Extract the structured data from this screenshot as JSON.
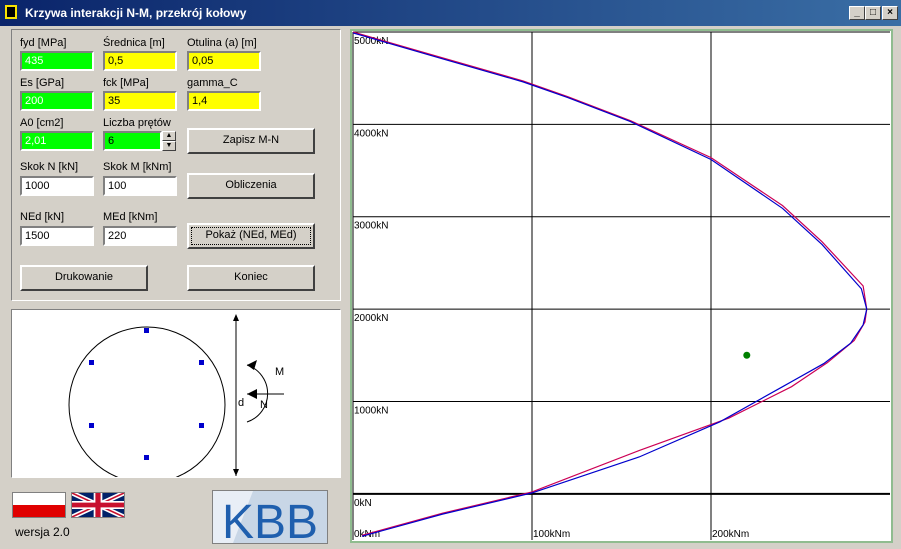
{
  "window": {
    "title": "Krzywa interakcji N-M, przekrój kołowy",
    "min_label": "_",
    "max_label": "□",
    "close_label": "×"
  },
  "inputs": {
    "fyd": {
      "label": "fyd [MPa]",
      "value": "435"
    },
    "srednica": {
      "label": "Średnica [m]",
      "value": "0,5"
    },
    "otulina": {
      "label": "Otulina (a) [m]",
      "value": "0,05"
    },
    "es": {
      "label": "Es [GPa]",
      "value": "200"
    },
    "fck": {
      "label": "fck [MPa]",
      "value": "35"
    },
    "gamma_c": {
      "label": "gamma_C",
      "value": "1,4"
    },
    "a0": {
      "label": "A0 [cm2]",
      "value": "2,01"
    },
    "liczba_pretow": {
      "label": "Liczba prętów",
      "value": "6"
    },
    "skok_n": {
      "label": "Skok N [kN]",
      "value": "1000"
    },
    "skok_m": {
      "label": "Skok M [kNm]",
      "value": "100"
    },
    "ned": {
      "label": "NEd [kN]",
      "value": "1500"
    },
    "med": {
      "label": "MEd [kNm]",
      "value": "220"
    }
  },
  "buttons": {
    "zapisz": "Zapisz M-N",
    "obliczenia": "Obliczenia",
    "pokaz": "Pokaż (NEd, MEd)",
    "drukowanie": "Drukowanie",
    "koniec": "Koniec"
  },
  "diagram": {
    "m_label": "M",
    "n_label": "N",
    "d_label": "d",
    "bars": 6
  },
  "logo_text": "KBB",
  "version": "wersja 2.0",
  "colors": {
    "curve1": "#cc0055",
    "curve2": "#0000cc",
    "point": "#008000",
    "green_field": "#00ff00",
    "yellow_field": "#ffff00"
  },
  "chart_data": {
    "type": "line",
    "xlabel": "",
    "ylabel": "",
    "xlim": [
      0,
      300
    ],
    "ylim": [
      -500,
      5000
    ],
    "x_ticks": [
      "0kNm",
      "100kNm",
      "200kNm"
    ],
    "y_ticks": [
      "0kN",
      "1000kN",
      "2000kN",
      "3000kN",
      "4000kN",
      "5000kN"
    ],
    "x_tick_values": [
      0,
      100,
      200
    ],
    "y_tick_values": [
      0,
      1000,
      2000,
      3000,
      4000,
      5000
    ],
    "grid": true,
    "series": [
      {
        "color": "#cc0055",
        "x": [
          0,
          50,
          95,
          120,
          155,
          200,
          240,
          262,
          285,
          287,
          286,
          280,
          265,
          245,
          210,
          160,
          100,
          50,
          5
        ],
        "y": [
          5000,
          4720,
          4470,
          4300,
          4040,
          3640,
          3120,
          2730,
          2250,
          2000,
          1860,
          1660,
          1420,
          1160,
          820,
          470,
          20,
          -210,
          -450
        ]
      },
      {
        "color": "#0000cc",
        "x": [
          0,
          50,
          95,
          120,
          155,
          200,
          240,
          262,
          284,
          287,
          285,
          278,
          263,
          240,
          205,
          160,
          100,
          50,
          5
        ],
        "y": [
          4990,
          4710,
          4460,
          4290,
          4030,
          3620,
          3090,
          2700,
          2220,
          2000,
          1830,
          1630,
          1410,
          1160,
          780,
          400,
          10,
          -220,
          -460
        ]
      }
    ],
    "points": [
      {
        "x": 220,
        "y": 1500,
        "color": "#008000"
      }
    ]
  }
}
